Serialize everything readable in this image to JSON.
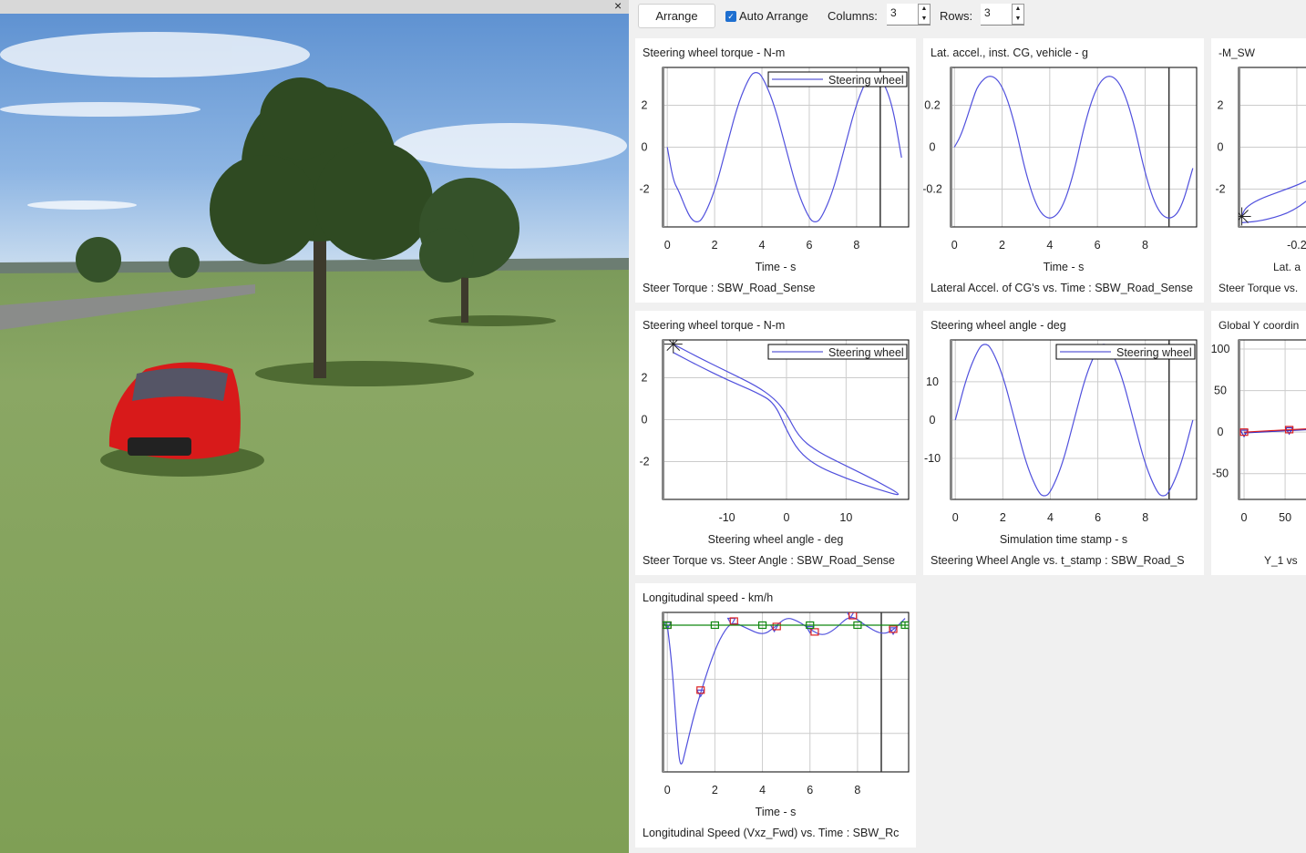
{
  "toolbar": {
    "arrange_label": "Arrange",
    "auto_arrange_label": "Auto Arrange",
    "auto_arrange_checked": true,
    "columns_label": "Columns:",
    "columns_value": "3",
    "rows_label": "Rows:",
    "rows_value": "3"
  },
  "scene": {
    "close_icon": "close-icon"
  },
  "colors": {
    "blue": "#3333cc",
    "red": "#dd2222",
    "green": "#118811",
    "accent": "#1e6fd0"
  },
  "chart_data": [
    {
      "type": "line",
      "title": "Steering wheel torque - N-m",
      "xlabel": "Time - s",
      "caption": "Steer Torque : SBW_Road_Sense",
      "legend": "Steering wheel",
      "xlim": [
        -0.2,
        10.2
      ],
      "ylim": [
        -3.8,
        3.8
      ],
      "xticks": [
        0,
        2,
        4,
        6,
        8
      ],
      "yticks": [
        2,
        0,
        -2
      ],
      "cursor": 9.0,
      "series": [
        {
          "color": "#5050dd",
          "points": [
            [
              0,
              0
            ],
            [
              0.25,
              -1.6
            ],
            [
              0.5,
              -2.12
            ],
            [
              0.75,
              -2.85
            ],
            [
              1,
              -3.42
            ],
            [
              1.25,
              -3.6
            ],
            [
              1.5,
              -3.42
            ],
            [
              2,
              -2.12
            ],
            [
              2.5,
              0
            ],
            [
              3,
              2.12
            ],
            [
              3.5,
              3.42
            ],
            [
              3.75,
              3.6
            ],
            [
              4,
              3.42
            ],
            [
              4.5,
              2.12
            ],
            [
              5,
              0
            ],
            [
              5.5,
              -2.12
            ],
            [
              6,
              -3.42
            ],
            [
              6.25,
              -3.6
            ],
            [
              6.5,
              -3.42
            ],
            [
              7,
              -2.12
            ],
            [
              7.5,
              0
            ],
            [
              8,
              2.12
            ],
            [
              8.5,
              3.42
            ],
            [
              8.75,
              3.6
            ],
            [
              9,
              3.42
            ],
            [
              9.5,
              2.12
            ],
            [
              9.9,
              -0.5
            ]
          ]
        }
      ]
    },
    {
      "type": "line",
      "title": "Lat. accel., inst. CG, vehicle - g",
      "xlabel": "Time - s",
      "caption": "Lateral Accel. of CG's vs. Time : SBW_Road_Sense",
      "xlim": [
        -0.16,
        10.16
      ],
      "ylim": [
        -0.38,
        0.38
      ],
      "xticks": [
        0,
        2,
        4,
        6,
        8
      ],
      "yticks": [
        0.2,
        0,
        -0.2
      ],
      "cursor": 9.0,
      "series": [
        {
          "color": "#5050dd",
          "points": [
            [
              0,
              0
            ],
            [
              0.25,
              0.05
            ],
            [
              0.5,
              0.13
            ],
            [
              0.75,
              0.22
            ],
            [
              1,
              0.3
            ],
            [
              1.5,
              0.35
            ],
            [
              2,
              0.3
            ],
            [
              2.5,
              0.13
            ],
            [
              3,
              -0.13
            ],
            [
              3.5,
              -0.3
            ],
            [
              4,
              -0.35
            ],
            [
              4.5,
              -0.3
            ],
            [
              5,
              -0.13
            ],
            [
              5.5,
              0.13
            ],
            [
              6,
              0.3
            ],
            [
              6.5,
              0.35
            ],
            [
              7,
              0.3
            ],
            [
              7.5,
              0.13
            ],
            [
              8,
              -0.13
            ],
            [
              8.5,
              -0.3
            ],
            [
              9,
              -0.35
            ],
            [
              9.5,
              -0.3
            ],
            [
              10,
              -0.1
            ]
          ]
        }
      ]
    },
    {
      "type": "line",
      "title": "-M_SW",
      "xlabel": "Lat. a",
      "caption": "Steer Torque vs.",
      "xlim": [
        -0.38,
        0.38
      ],
      "ylim": [
        -3.8,
        3.8
      ],
      "xticks": [
        -0.2
      ],
      "yticks": [
        2,
        0,
        -2
      ],
      "series": [
        {
          "color": "#5050dd",
          "marker": "star",
          "points": [
            [
              -0.37,
              -3.3
            ],
            [
              -0.36,
              -2.9
            ],
            [
              -0.32,
              -2.5
            ],
            [
              -0.25,
              -2.1
            ],
            [
              -0.18,
              -1.7
            ],
            [
              -0.1,
              -1.0
            ],
            [
              0,
              0
            ],
            [
              0.1,
              1.0
            ],
            [
              0.2,
              1.8
            ],
            [
              0.3,
              2.4
            ],
            [
              0.36,
              2.9
            ],
            [
              0.37,
              3.4
            ],
            [
              0.36,
              3.6
            ],
            [
              0.3,
              3.4
            ],
            [
              0.2,
              3.0
            ],
            [
              0.1,
              2.2
            ],
            [
              0,
              1.0
            ],
            [
              -0.1,
              -1.6
            ],
            [
              -0.2,
              -3.0
            ],
            [
              -0.3,
              -3.5
            ],
            [
              -0.37,
              -3.6
            ]
          ]
        }
      ]
    },
    {
      "type": "line",
      "title": "Steering wheel torque - N-m",
      "xlabel": "Steering wheel angle - deg",
      "caption": "Steer Torque vs. Steer Angle : SBW_Road_Sense",
      "legend": "Steering wheel",
      "xlim": [
        -20.8,
        20.5
      ],
      "ylim": [
        -3.8,
        3.8
      ],
      "xticks": [
        -10,
        0,
        10
      ],
      "yticks": [
        2,
        0,
        -2
      ],
      "series": [
        {
          "color": "#5050dd",
          "marker": "star",
          "points": [
            [
              -19,
              3.6
            ],
            [
              -15,
              3.0
            ],
            [
              -10,
              2.3
            ],
            [
              -5,
              1.6
            ],
            [
              -2,
              1.0
            ],
            [
              0,
              0.3
            ],
            [
              2,
              -0.8
            ],
            [
              5,
              -1.5
            ],
            [
              10,
              -2.2
            ],
            [
              15,
              -2.9
            ],
            [
              20,
              -3.7
            ],
            [
              15,
              -3.3
            ],
            [
              10,
              -2.8
            ],
            [
              5,
              -2.2
            ],
            [
              2,
              -1.5
            ],
            [
              0,
              -0.5
            ],
            [
              -2,
              0.8
            ],
            [
              -5,
              1.3
            ],
            [
              -10,
              1.9
            ],
            [
              -15,
              2.6
            ],
            [
              -19,
              3.2
            ]
          ]
        }
      ]
    },
    {
      "type": "line",
      "title": "Steering wheel angle - deg",
      "xlabel": "Simulation time stamp - s",
      "caption": "Steering Wheel Angle vs. t_stamp : SBW_Road_S",
      "legend": "Steering wheel",
      "xlim": [
        -0.2,
        10.16
      ],
      "ylim": [
        -20.7,
        20.9
      ],
      "xticks": [
        0,
        2,
        4,
        6,
        8
      ],
      "yticks": [
        10,
        0,
        -10
      ],
      "cursor": 9.0,
      "series": [
        {
          "color": "#5050dd",
          "points": [
            [
              0,
              0
            ],
            [
              0.5,
              11.8
            ],
            [
              1,
              19
            ],
            [
              1.25,
              20
            ],
            [
              1.5,
              19
            ],
            [
              2,
              11.8
            ],
            [
              2.5,
              0
            ],
            [
              3,
              -11.8
            ],
            [
              3.5,
              -19
            ],
            [
              3.75,
              -20
            ],
            [
              4,
              -19
            ],
            [
              4.5,
              -11.8
            ],
            [
              5,
              0
            ],
            [
              5.5,
              11.8
            ],
            [
              6,
              19
            ],
            [
              6.25,
              20
            ],
            [
              6.5,
              19
            ],
            [
              7,
              11.8
            ],
            [
              7.5,
              0
            ],
            [
              8,
              -11.8
            ],
            [
              8.5,
              -19
            ],
            [
              8.75,
              -20
            ],
            [
              9,
              -19
            ],
            [
              9.5,
              -11.8
            ],
            [
              10,
              0
            ]
          ]
        }
      ]
    },
    {
      "type": "line",
      "title": "Global Y coordin",
      "xlabel": "",
      "caption": "Y_1 vs",
      "xlim": [
        -6.7,
        293
      ],
      "ylim": [
        -81,
        111
      ],
      "xticks": [
        0,
        50
      ],
      "yticks": [
        100,
        50,
        0,
        -50
      ],
      "series": [
        {
          "color": "#3333cc",
          "marker": "triangle",
          "points": [
            [
              0,
              -1
            ],
            [
              55,
              2
            ],
            [
              120,
              5
            ],
            [
              200,
              8
            ]
          ]
        },
        {
          "color": "#dd2222",
          "marker": "square",
          "points": [
            [
              0,
              0
            ],
            [
              55,
              3
            ],
            [
              120,
              6
            ],
            [
              200,
              9
            ]
          ]
        }
      ]
    },
    {
      "type": "line",
      "title": "Longitudinal speed - km/h",
      "xlabel": "Time - s",
      "caption": "Longitudinal Speed (Vxz_Fwd) vs. Time : SBW_Rc",
      "xlim": [
        -0.2,
        10.15
      ],
      "ylim": [
        45.8,
        104.7
      ],
      "xticks": [
        0,
        2,
        4,
        6,
        8
      ],
      "yticks": [],
      "ygrid": [
        60,
        80,
        100
      ],
      "cursor": 9.0,
      "series": [
        {
          "color": "#5050dd",
          "marker": "triangle",
          "markerAt": [
            0,
            1.4,
            2.75,
            4.5,
            6.1,
            7.7,
            9.4
          ],
          "points": [
            [
              0,
              100
            ],
            [
              0.2,
              85
            ],
            [
              0.4,
              60
            ],
            [
              0.55,
              46
            ],
            [
              0.8,
              55
            ],
            [
              1.1,
              66
            ],
            [
              1.4,
              75
            ],
            [
              1.8,
              86
            ],
            [
              2.2,
              95
            ],
            [
              2.7,
              101.5
            ],
            [
              3.3,
              99
            ],
            [
              4,
              96.2
            ],
            [
              4.5,
              99
            ],
            [
              5,
              103
            ],
            [
              5.5,
              101.5
            ],
            [
              6,
              98.5
            ],
            [
              6.5,
              96
            ],
            [
              7,
              98
            ],
            [
              7.7,
              104
            ],
            [
              8.3,
              100
            ],
            [
              9,
              96.5
            ],
            [
              9.5,
              98
            ],
            [
              10,
              102.5
            ]
          ]
        },
        {
          "color": "#dd2222",
          "marker": "square",
          "markerOnly": true,
          "points": [
            [
              0,
              100
            ],
            [
              1.4,
              76
            ],
            [
              2.8,
              101.5
            ],
            [
              4.6,
              99.5
            ],
            [
              6.2,
              97.5
            ],
            [
              7.8,
              103.5
            ],
            [
              9.5,
              98.5
            ]
          ]
        },
        {
          "color": "#118811",
          "marker": "square",
          "points": [
            [
              -0.2,
              100
            ],
            [
              0,
              100
            ],
            [
              2,
              100
            ],
            [
              4,
              100
            ],
            [
              6,
              100
            ],
            [
              8,
              100
            ],
            [
              10,
              100
            ],
            [
              10.15,
              100
            ]
          ]
        }
      ]
    }
  ]
}
